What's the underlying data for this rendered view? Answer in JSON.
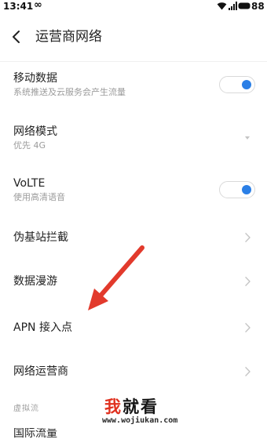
{
  "status_bar": {
    "time": "13:41",
    "link_glyph": "∞",
    "battery_percent": "88",
    "icons": [
      "wifi-icon",
      "signal-icon",
      "battery-icon"
    ]
  },
  "header": {
    "back_icon": "chevron-left-icon",
    "title": "运营商网络"
  },
  "items": [
    {
      "label": "移动数据",
      "sublabel": "系统推送及云服务会产生流量",
      "toggle_on": true
    },
    {
      "label": "网络模式",
      "sublabel": "优先 4G",
      "icon": "dropdown-arrow-icon"
    },
    {
      "label": "VoLTE",
      "sublabel": "使用高清语音",
      "toggle_on": true
    },
    {
      "label": "伪基站拦截",
      "icon": "chevron-right-icon"
    },
    {
      "label": "数据漫游",
      "icon": "chevron-right-icon"
    },
    {
      "label": "APN 接入点",
      "icon": "chevron-right-icon"
    },
    {
      "label": "网络运营商",
      "icon": "chevron-right-icon"
    }
  ],
  "section_label": "虚拟流",
  "partial_item": {
    "label": "国际流量"
  },
  "watermark": {
    "brand_red": "我",
    "brand_dark": "就看",
    "url": "www.wojiukan.com"
  },
  "annotation_icon": "red-arrow-icon",
  "colors": {
    "accent": "#2b7fe6",
    "text_primary": "#222222",
    "text_secondary": "#9b9b9b",
    "chevron": "#c4c4c4",
    "watermark_red": "#e0311f",
    "arrow": "#e23a2c"
  }
}
